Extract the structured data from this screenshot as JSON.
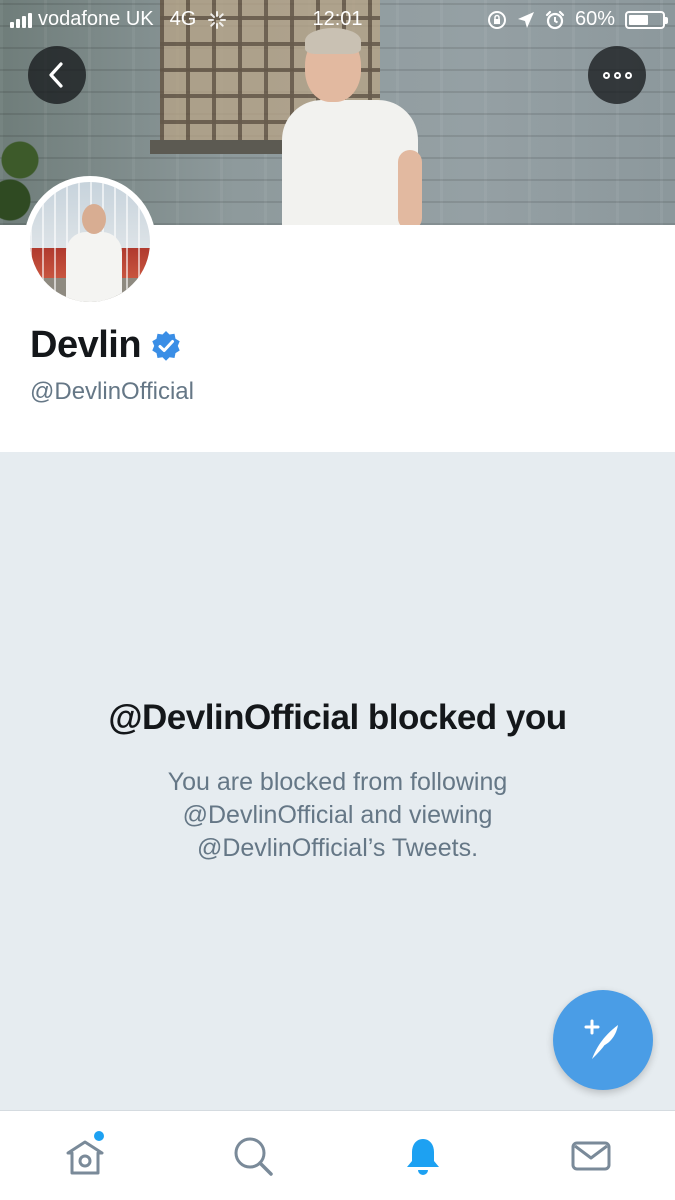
{
  "status_bar": {
    "carrier": "vodafone UK",
    "network": "4G",
    "time": "12:01",
    "battery_percent": "60%",
    "battery_level": 0.6
  },
  "header": {
    "back_icon": "chevron-left-icon",
    "more_icon": "more-horizontal-icon"
  },
  "profile": {
    "display_name": "Devlin",
    "verified": true,
    "handle": "@DevlinOfficial"
  },
  "blocked": {
    "title": "@DevlinOfficial blocked you",
    "line1": "You are blocked from following",
    "line2": "@DevlinOfficial and viewing",
    "line3": "@DevlinOfficial’s Tweets."
  },
  "compose": {
    "icon": "compose-tweet-icon"
  },
  "tab_bar": {
    "tabs": [
      {
        "name": "home",
        "icon": "home-icon",
        "has_notification_dot": true
      },
      {
        "name": "search",
        "icon": "search-icon"
      },
      {
        "name": "notifications",
        "icon": "bell-icon",
        "active": true
      },
      {
        "name": "messages",
        "icon": "envelope-icon"
      }
    ]
  },
  "colors": {
    "accent": "#1da1f2",
    "fab": "#4a9de6",
    "text_primary": "#14171a",
    "text_secondary": "#657786",
    "background": "#e6ecf0"
  }
}
